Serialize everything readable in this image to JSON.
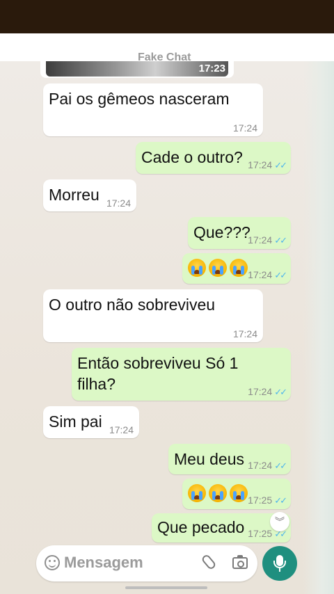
{
  "image_message": {
    "caption": "Fake Chat",
    "time": "17:23"
  },
  "messages": [
    {
      "direction": "in",
      "text": "Pai os gêmeos nasceram",
      "time": "17:24"
    },
    {
      "direction": "out",
      "text": "Cade o outro?",
      "time": "17:24"
    },
    {
      "direction": "in",
      "text": "Morreu",
      "time": "17:24"
    },
    {
      "direction": "out",
      "text": "Que???",
      "time": "17:24"
    },
    {
      "direction": "out",
      "text": "😭😭😭",
      "time": "17:24"
    },
    {
      "direction": "in",
      "text": "O outro não sobreviveu",
      "time": "17:24"
    },
    {
      "direction": "out",
      "text": "Então sobreviveu Só 1 filha?",
      "time": "17:24"
    },
    {
      "direction": "in",
      "text": "Sim pai",
      "time": "17:24"
    },
    {
      "direction": "out",
      "text": "Meu deus",
      "time": "17:24"
    },
    {
      "direction": "out",
      "text": "😭😭😭",
      "time": "17:25"
    },
    {
      "direction": "out",
      "text": "Que pecado",
      "time": "17:25"
    }
  ],
  "read_receipt": "✓✓",
  "scroll_down_icon": "double-chevron-down",
  "input": {
    "placeholder": "Mensagem"
  },
  "colors": {
    "incoming": "#ffffff",
    "outgoing": "#dcf8c6",
    "accent": "#1f8f7f",
    "ticks": "#4fb6ec"
  }
}
